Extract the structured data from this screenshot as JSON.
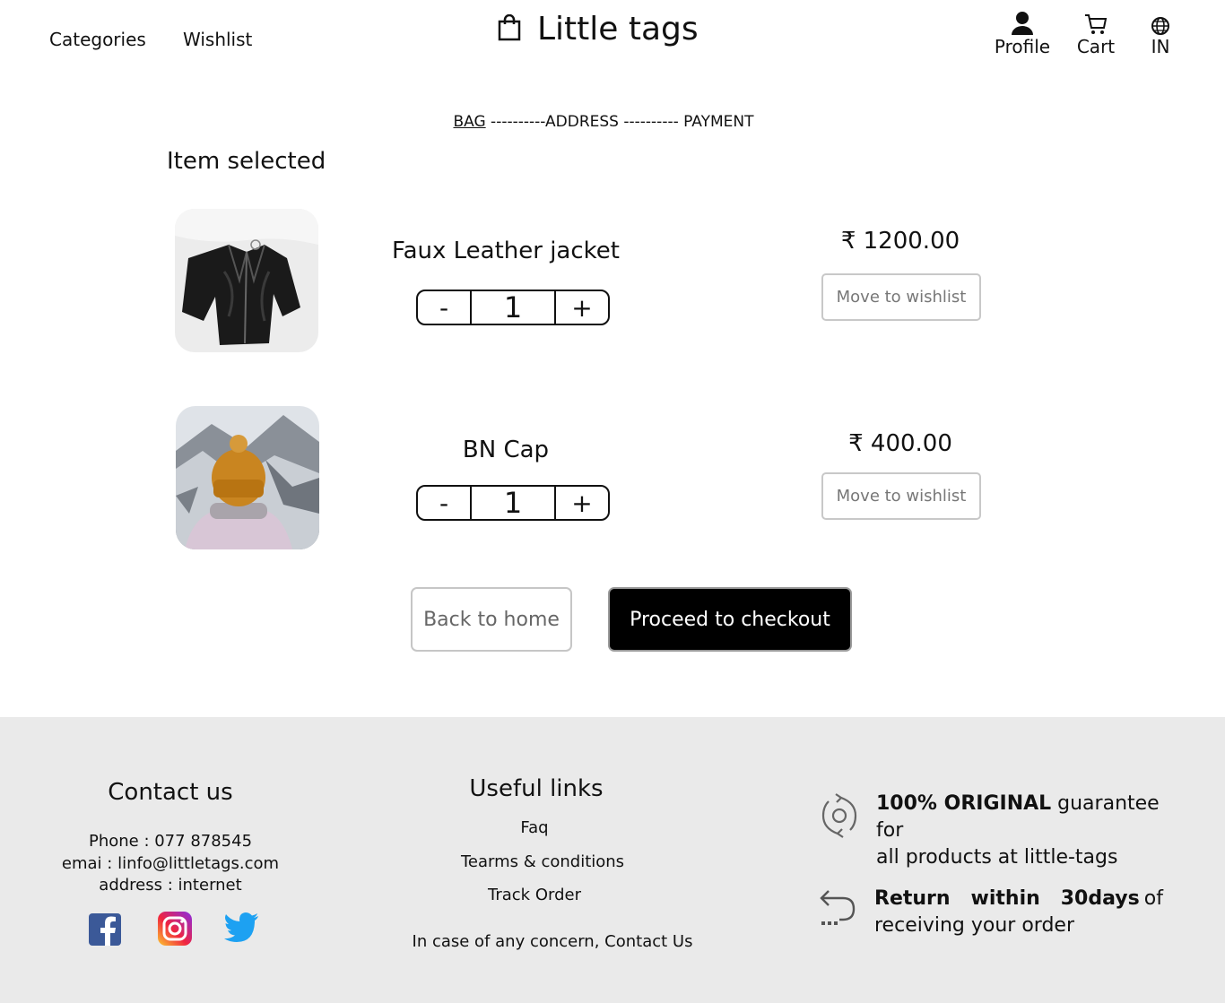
{
  "header": {
    "nav": [
      "Categories",
      "Wishlist"
    ],
    "brand": "Little tags",
    "icons": [
      {
        "label": "Profile",
        "icon": "user-icon"
      },
      {
        "label": "Cart",
        "icon": "cart-icon"
      },
      {
        "label": "IN",
        "icon": "globe-icon"
      }
    ]
  },
  "steps": {
    "active": "BAG",
    "rest": " ----------ADDRESS ---------- PAYMENT"
  },
  "cart": {
    "title": "Item selected",
    "items": [
      {
        "name": "Faux Leather jacket",
        "qty": "1",
        "currency": "₹",
        "price": "1200.00",
        "wishlist_label": "Move to wishlist",
        "minus": "-",
        "plus": "+"
      },
      {
        "name": "BN Cap",
        "qty": "1",
        "currency": "₹",
        "price": "400.00",
        "wishlist_label": "Move to wishlist",
        "minus": "-",
        "plus": "+"
      }
    ],
    "back_label": "Back to home",
    "checkout_label": "Proceed to checkout"
  },
  "footer": {
    "contact": {
      "title": "Contact us",
      "phone": "Phone  : 077 878545",
      "email": "emai : linfo@littletags.com",
      "address": "address : internet",
      "social": [
        "facebook-icon",
        "instagram-icon",
        "twitter-icon"
      ]
    },
    "links": {
      "title": "Useful links",
      "items": [
        "Faq",
        "Tearms & conditions",
        "Track Order"
      ],
      "note": "In case of any concern, Contact Us"
    },
    "promos": [
      {
        "bold": "100% ORIGINAL",
        "text1": " guarantee for",
        "text2": "all products at little-tags"
      },
      {
        "bold": "Return   within   30days",
        "text1": "of",
        "text2": "receiving your order"
      }
    ]
  },
  "colors": {
    "footer_bg": "#eaeaea",
    "facebook": "#3b5998",
    "twitter": "#1da1f2",
    "checkout_bg": "#000000"
  }
}
